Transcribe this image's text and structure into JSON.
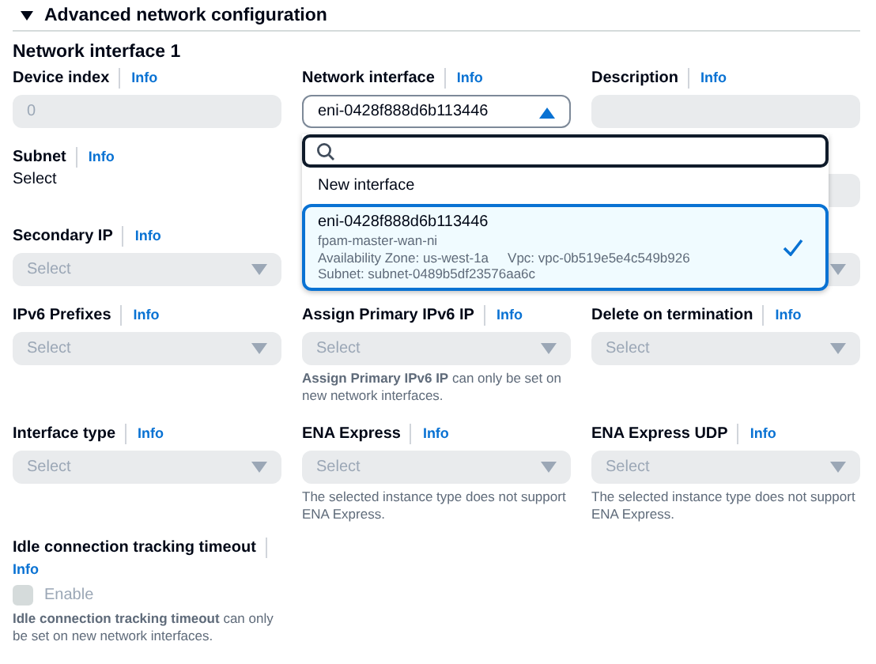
{
  "header": {
    "title": "Advanced network configuration",
    "expanded": true
  },
  "section_title": "Network interface 1",
  "fields": [
    {
      "kind": "input",
      "label": "Device index",
      "info": "Info",
      "placeholder": "0",
      "disabled": true
    },
    {
      "kind": "select",
      "label": "Network interface",
      "info": "Info",
      "value": "eni-0428f888d6b113446",
      "disabled": false,
      "open": true
    },
    {
      "kind": "input",
      "label": "Description",
      "info": "Info",
      "disabled": true
    },
    {
      "kind": "text",
      "label": "Subnet",
      "info": "Info",
      "value": "Select"
    },
    {
      "kind": "covered"
    },
    {
      "kind": "input",
      "disabled": true
    },
    {
      "kind": "select",
      "label": "Secondary IP",
      "info": "Info",
      "placeholder": "Select",
      "disabled": true,
      "open": false
    },
    {
      "kind": "covered"
    },
    {
      "kind": "select",
      "disabled": true,
      "open": false
    },
    {
      "kind": "select",
      "label": "IPv6 Prefixes",
      "info": "Info",
      "placeholder": "Select",
      "disabled": true,
      "open": false
    },
    {
      "kind": "select",
      "label": "Assign Primary IPv6 IP",
      "info": "Info",
      "placeholder": "Select",
      "disabled": true,
      "open": false,
      "help": "**Assign Primary IPv6 IP** can only be set on new network interfaces."
    },
    {
      "kind": "select",
      "label": "Delete on termination",
      "info": "Info",
      "placeholder": "Select",
      "disabled": true,
      "open": false
    },
    {
      "kind": "select",
      "label": "Interface type",
      "info": "Info",
      "placeholder": "Select",
      "disabled": true,
      "open": false
    },
    {
      "kind": "select",
      "label": "ENA Express",
      "info": "Info",
      "placeholder": "Select",
      "disabled": true,
      "open": false,
      "help": "The selected instance type does not support ENA Express."
    },
    {
      "kind": "select",
      "label": "ENA Express UDP",
      "info": "Info",
      "placeholder": "Select",
      "disabled": true,
      "open": false,
      "help": "The selected instance type does not support ENA Express."
    },
    {
      "kind": "checkbox",
      "label": "Idle connection tracking timeout",
      "info": "Info",
      "option": "Enable",
      "checked": false,
      "disabled": true,
      "help": "**Idle connection tracking timeout** can only be set on new network interfaces."
    }
  ],
  "dropdown": {
    "options": [
      {
        "label": "New interface",
        "selected": false
      },
      {
        "label": "eni-0428f888d6b113446",
        "selected": true,
        "lines": [
          [
            "fpam-master-wan-ni"
          ],
          [
            "Availability Zone: us-west-1a",
            "Vpc: vpc-0b519e5e4c549b926"
          ],
          [
            "Subnet: subnet-0489b5df23576aa6c"
          ]
        ]
      }
    ]
  }
}
